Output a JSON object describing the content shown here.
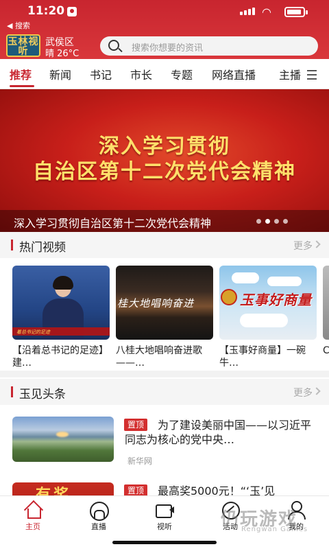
{
  "status_bar": {
    "time": "11:20"
  },
  "back_link": "◀ 搜索",
  "header": {
    "logo_text": "玉林视听",
    "district": "武侯区",
    "weather": "晴 26°C",
    "search_placeholder": "搜索你想要的资讯"
  },
  "tabs": [
    {
      "label": "推荐",
      "active": true
    },
    {
      "label": "新闻"
    },
    {
      "label": "书记"
    },
    {
      "label": "市长"
    },
    {
      "label": "专题"
    },
    {
      "label": "网络直播"
    },
    {
      "label": "主播"
    }
  ],
  "banner": {
    "line1": "深入学习贯彻",
    "line2": "自治区第十二次党代会精神",
    "caption": "深入学习贯彻自治区第十二次党代会精神",
    "slide_index": 1,
    "slide_count": 4
  },
  "hot_videos": {
    "title": "热门视频",
    "more": "更多",
    "items": [
      {
        "title": "【沿着总书记的足迹】建…",
        "thumb_text": "着总书记的足迹"
      },
      {
        "title": "八桂大地唱响奋进歌——…",
        "thumb_text": "桂大地唱响奋进"
      },
      {
        "title": "【玉事好商量】一碗牛…",
        "thumb_text": "玉事好商量"
      },
      {
        "title": "C"
      }
    ]
  },
  "headlines": {
    "title": "玉见头条",
    "more": "更多",
    "items": [
      {
        "tag": "置顶",
        "title": "为了建设美丽中国——以习近平同志为核心的党中央…",
        "source": "新华网"
      },
      {
        "tag": "置顶",
        "title": "最高奖5000元！“‘玉’见",
        "image_text": "有奖"
      }
    ]
  },
  "bottom_nav": [
    {
      "label": "主页",
      "icon": "home-icon",
      "active": true
    },
    {
      "label": "直播",
      "icon": "live-icon"
    },
    {
      "label": "视听",
      "icon": "video-icon"
    },
    {
      "label": "活动",
      "icon": "activity-icon"
    },
    {
      "label": "我的",
      "icon": "user-icon"
    }
  ],
  "watermark": {
    "main": "仍玩游戏",
    "sub": "Rengwan Games"
  },
  "colors": {
    "brand_red": "#c8252f",
    "banner_gold": "#ffe06b"
  }
}
